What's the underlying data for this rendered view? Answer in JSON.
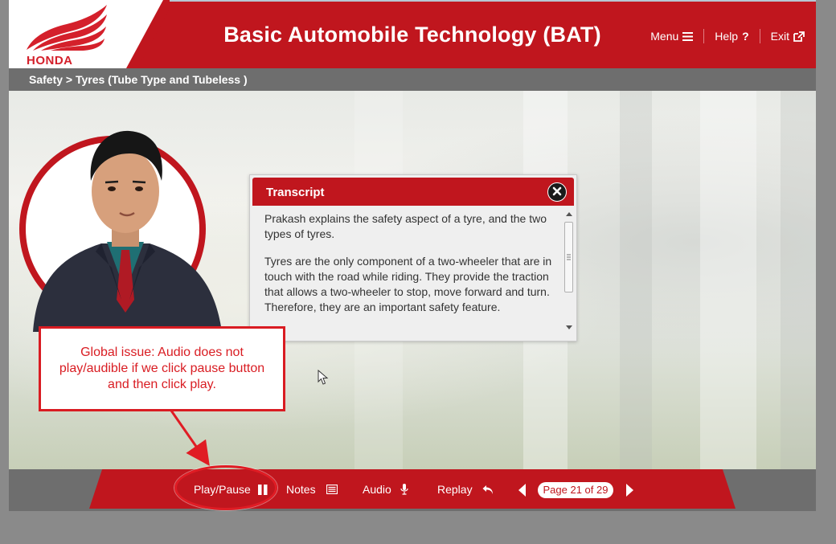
{
  "app": {
    "title": "Basic Automobile Technology (BAT)",
    "brand": "HONDA",
    "colors": {
      "primary_red": "#c0161e",
      "bar_gray": "#6e6e6e",
      "annotation_red": "#d91c22"
    }
  },
  "top_nav": {
    "menu": {
      "label": "Menu",
      "icon": "hamburger-icon"
    },
    "help": {
      "label": "Help",
      "icon": "question-icon"
    },
    "exit": {
      "label": "Exit",
      "icon": "external-link-icon"
    }
  },
  "breadcrumb": "Safety > Tyres (Tube Type and Tubeless )",
  "transcript": {
    "title": "Transcript",
    "paragraphs": [
      "Prakash explains the safety aspect of a tyre, and the two types of tyres.",
      "Tyres are the only component of a two-wheeler that are in touch with the road while riding. They provide the traction that allows a two-wheeler to stop, move forward and turn. Therefore, they are an important safety feature."
    ]
  },
  "annotation": {
    "text": "Global issue: Audio does not play/audible if we click pause button and then click play."
  },
  "footer": {
    "play_pause": {
      "label": "Play/Pause",
      "icon": "pause-icon"
    },
    "notes": {
      "label": "Notes",
      "icon": "notes-icon"
    },
    "audio": {
      "label": "Audio",
      "icon": "microphone-icon"
    },
    "replay": {
      "label": "Replay",
      "icon": "replay-icon"
    },
    "page_indicator": "Page 21 of 29"
  }
}
